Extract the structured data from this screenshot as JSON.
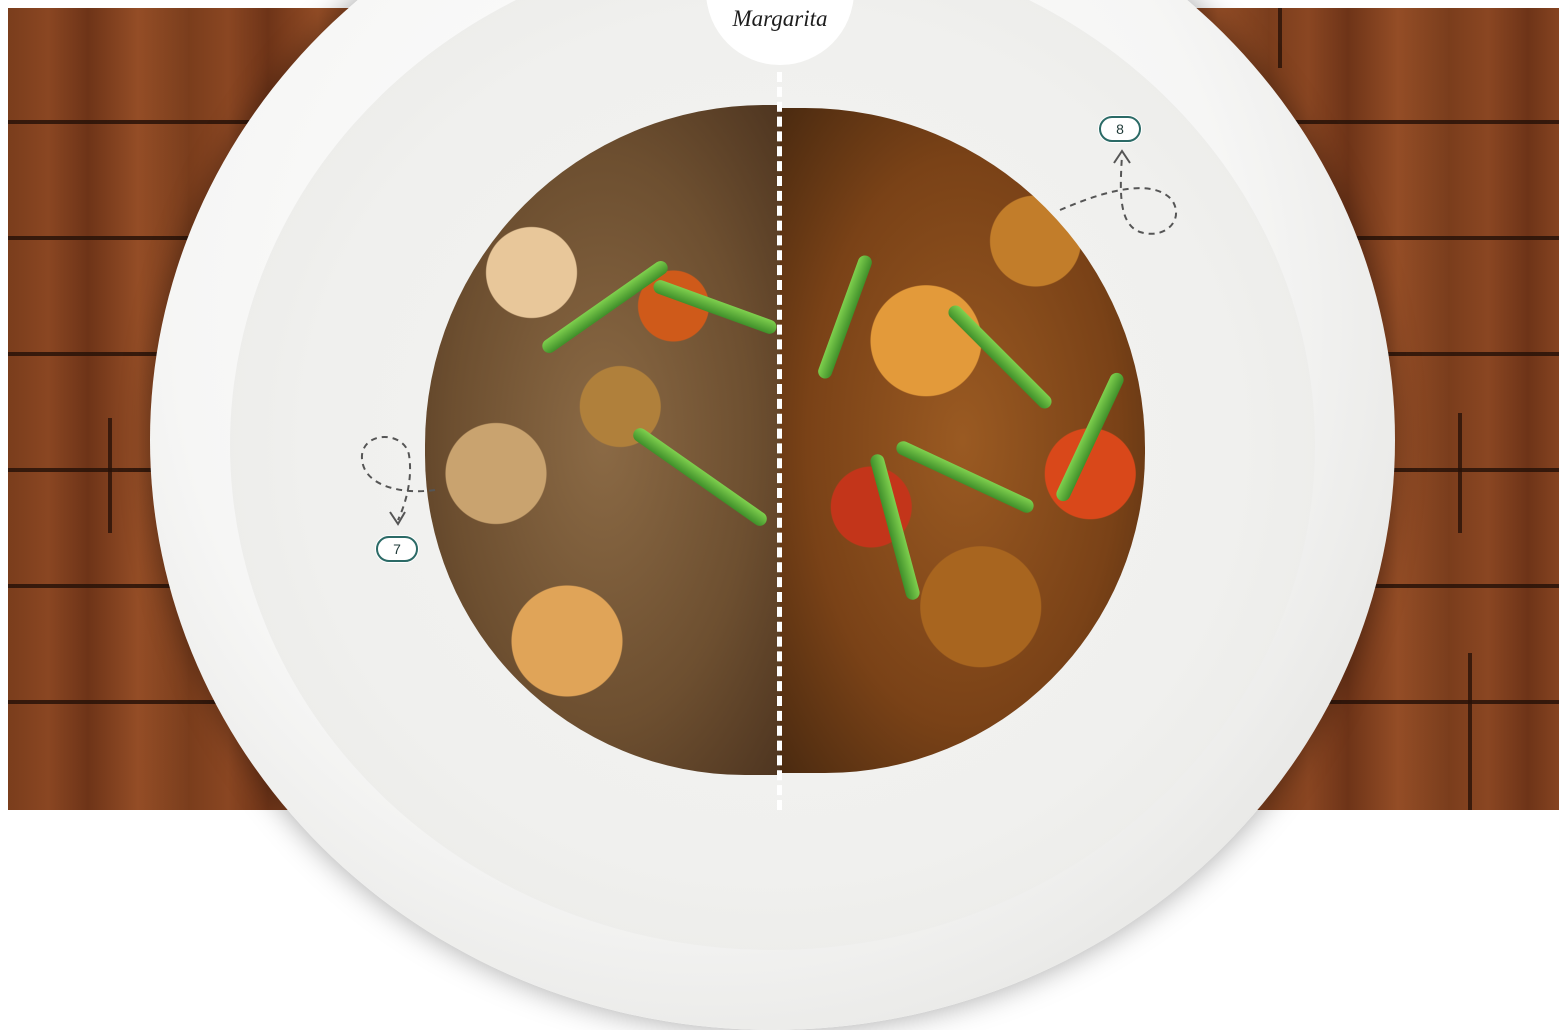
{
  "logo": {
    "text": "Margarita"
  },
  "markers": [
    {
      "label": "7"
    },
    {
      "label": "8"
    }
  ],
  "colors": {
    "badge_border": "#2b6a66",
    "divider": "#ffffff",
    "wood": "#7a3d1c",
    "plate": "#f4f4f2"
  },
  "icons": {
    "connector_7": "dashed-loop-arrow-icon",
    "connector_8": "dashed-loop-arrow-icon"
  }
}
